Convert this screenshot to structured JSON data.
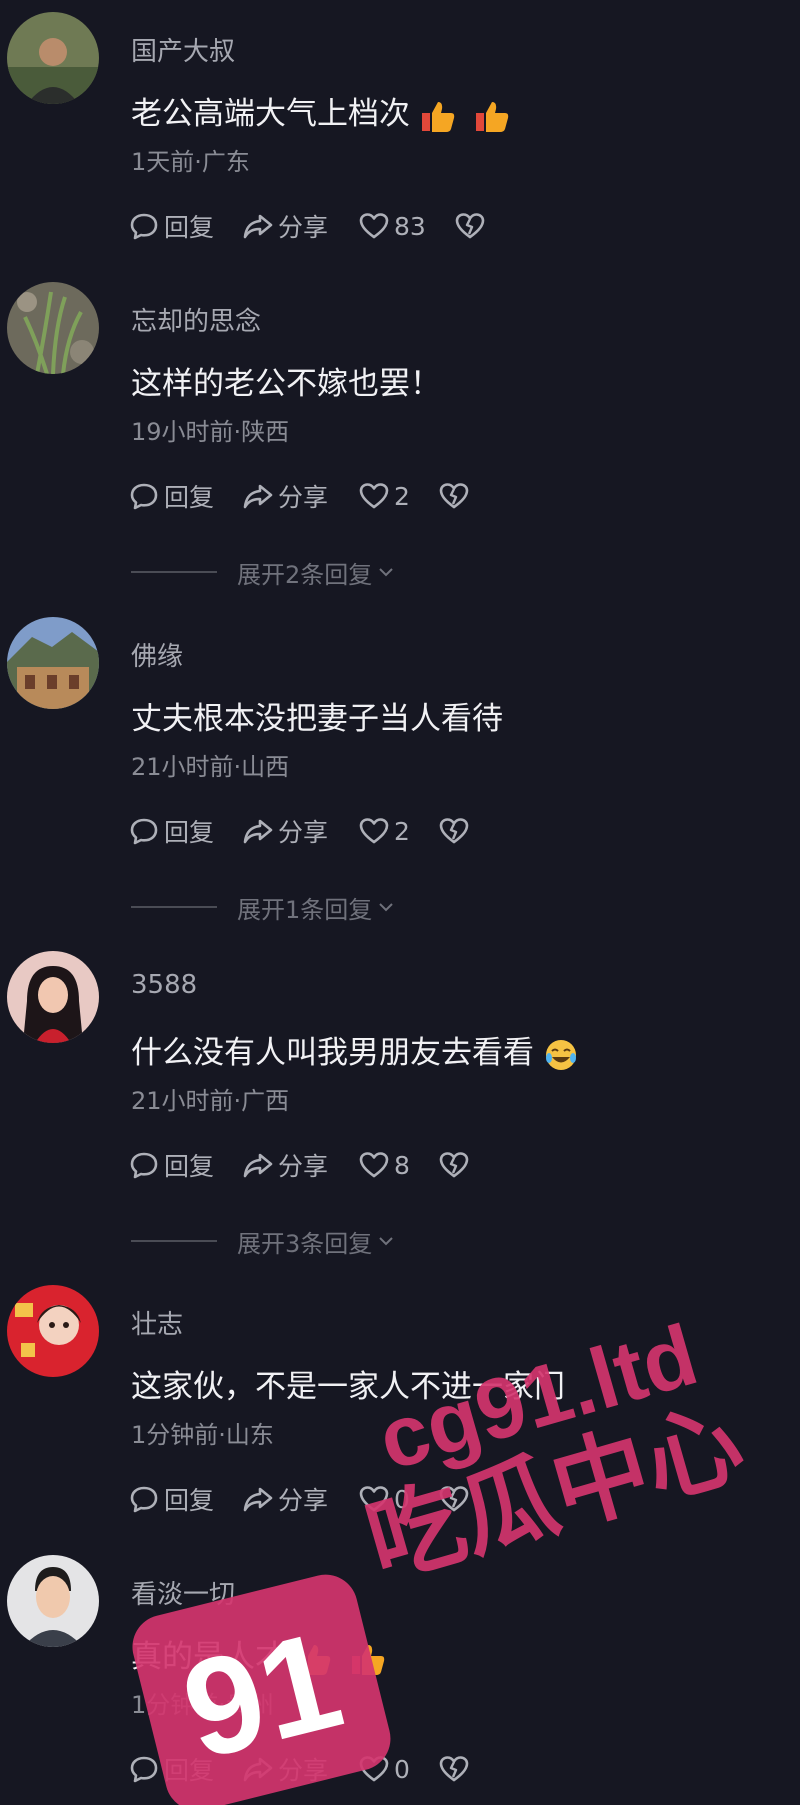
{
  "comments": [
    {
      "username": "国产大叔",
      "text": "老公高端大气上档次",
      "meta": "1天前·广东",
      "reply_label": "回复",
      "share_label": "分享",
      "likes": "83",
      "emojis": [
        "thumbs-up",
        "thumbs-up"
      ]
    },
    {
      "username": "忘却的思念",
      "text": "这样的老公不嫁也罢！",
      "meta": "19小时前·陕西",
      "reply_label": "回复",
      "share_label": "分享",
      "likes": "2",
      "expand": "展开2条回复"
    },
    {
      "username": "佛缘",
      "text": "丈夫根本没把妻子当人看待",
      "meta": "21小时前·山西",
      "reply_label": "回复",
      "share_label": "分享",
      "likes": "2",
      "expand": "展开1条回复"
    },
    {
      "username": "3588",
      "text": "什么没有人叫我男朋友去看看",
      "meta": "21小时前·广西",
      "reply_label": "回复",
      "share_label": "分享",
      "likes": "8",
      "expand": "展开3条回复",
      "emojis": [
        "laughing-face"
      ]
    },
    {
      "username": "壮志",
      "text": "这家伙，不是一家人不进一家门",
      "meta": "1分钟前·山东",
      "reply_label": "回复",
      "share_label": "分享",
      "likes": "0"
    },
    {
      "username": "看淡一切",
      "text": "真的是人才",
      "meta": "1分钟前·贵州",
      "reply_label": "回复",
      "share_label": "分享",
      "likes": "0",
      "emojis": [
        "thumbs-up",
        "thumbs-up"
      ]
    }
  ],
  "watermark": {
    "logo_text": "91",
    "domain": "cg91.ltd",
    "name": "吃瓜中心",
    "color": "#d4356e"
  },
  "colors": {
    "background": "#161722",
    "username": "#a6a8b1",
    "meta": "#8a8c95"
  }
}
